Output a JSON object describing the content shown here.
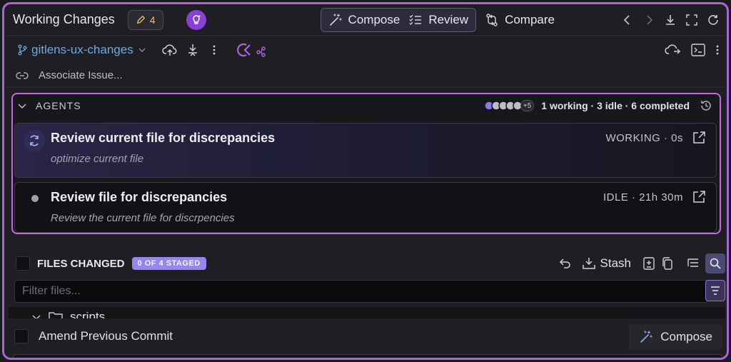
{
  "header": {
    "title": "Working Changes",
    "changes_count": "4",
    "compose_label": "Compose",
    "review_label": "Review",
    "compare_label": "Compare"
  },
  "branch": {
    "name": "gitlens-ux-changes"
  },
  "issue": {
    "associate_label": "Associate Issue..."
  },
  "agents": {
    "section_label": "AGENTS",
    "avatar_overflow": "+5",
    "summary": "1 working · 3 idle · 6 completed",
    "items": [
      {
        "title": "Review current file for discrepancies",
        "subtitle": "optimize current file",
        "status": "WORKING · 0s"
      },
      {
        "title": "Review file for discrepancies",
        "subtitle": "Review the current file for discrpencies",
        "status": "IDLE · 21h 30m"
      }
    ]
  },
  "files": {
    "section_label": "FILES CHANGED",
    "staged_badge": "0 OF 4 STAGED",
    "stash_label": "Stash",
    "filter_placeholder": "Filter files...",
    "tree_folder": "scripts"
  },
  "commit": {
    "amend_label": "Amend Previous Commit",
    "compose_label": "Compose"
  },
  "colors": {
    "accent": "#a866d8",
    "branch": "#6ea7e6",
    "staged_badge": "#9a84ee",
    "count_pencil": "#e8c36a"
  }
}
